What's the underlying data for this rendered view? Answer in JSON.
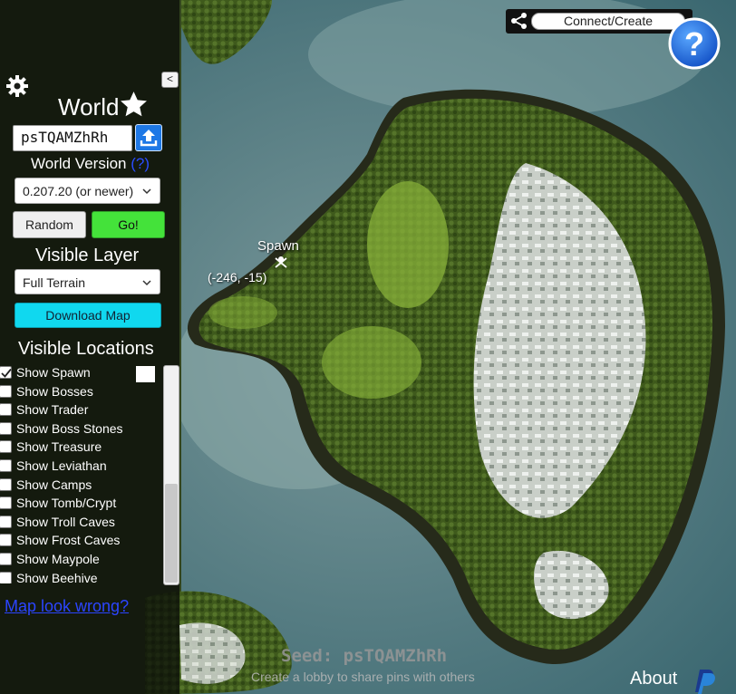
{
  "sidebar": {
    "collapse_label": "<",
    "world_title": "World",
    "seed_value": "psTQAMZhRh",
    "world_version_label": "World Version",
    "world_version_help": "(?)",
    "version_selected": "0.207.20 (or newer)",
    "random_label": "Random",
    "go_label": "Go!",
    "visible_layer_label": "Visible Layer",
    "layer_selected": "Full Terrain",
    "download_label": "Download Map",
    "visible_locations_label": "Visible Locations",
    "locations": [
      {
        "label": "Show Spawn",
        "checked": true
      },
      {
        "label": "Show Bosses",
        "checked": false
      },
      {
        "label": "Show Trader",
        "checked": false
      },
      {
        "label": "Show Boss Stones",
        "checked": false
      },
      {
        "label": "Show Treasure",
        "checked": false
      },
      {
        "label": "Show Leviathan",
        "checked": false
      },
      {
        "label": "Show Camps",
        "checked": false
      },
      {
        "label": "Show Tomb/Crypt",
        "checked": false
      },
      {
        "label": "Show Troll Caves",
        "checked": false
      },
      {
        "label": "Show Frost Caves",
        "checked": false
      },
      {
        "label": "Show Maypole",
        "checked": false
      },
      {
        "label": "Show Beehive",
        "checked": false
      }
    ],
    "map_wrong_link": "Map look wrong?"
  },
  "topbar": {
    "connect_label": "Connect/Create"
  },
  "map": {
    "spawn_label": "Spawn",
    "spawn_coords": "(-246, -15)",
    "seed_overlay": "Seed: psTQAMZhRh",
    "lobby_hint": "Create a lobby to share pins with others"
  },
  "footer": {
    "about_label": "About"
  },
  "colors": {
    "go_button": "#44e23a",
    "download_button": "#10d8ef",
    "upload_button": "#1e78e6",
    "help_button": "#1e6fe0",
    "link": "#2b45ff",
    "ocean": "#3f6d76"
  },
  "icons": {
    "settings": "gear-icon",
    "favorite": "star-icon",
    "upload": "upload-icon",
    "share": "share-icon",
    "help": "help-icon",
    "spawn": "spawn-marker-icon",
    "paypal": "paypal-icon"
  }
}
